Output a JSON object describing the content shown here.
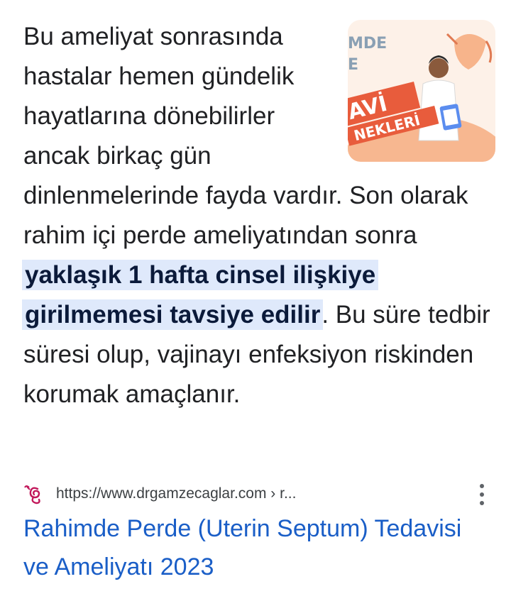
{
  "snippet": {
    "part1": "Bu ameliyat sonrasında hastalar hemen gündelik hayatlarına dönebilirler ancak birkaç gün dinlenmelerinde fayda vardır. Son olarak rahim içi perde ameliyatından sonra ",
    "highlight": "yaklaşık 1 hafta cinsel ilişkiye girilmemesi tavsiye edilir",
    "part2": ". Bu süre tedbir süresi olup, vajinayı enfeksiyon riskinden korumak amaçlanır."
  },
  "thumbnail": {
    "text_line1": "MDE",
    "text_line2": "E",
    "text_line3": "AVİ",
    "text_line4": "NEKLERİ",
    "colors": {
      "bg": "#fdeee3",
      "accent": "#f28b5b",
      "banner": "#e85c3c"
    }
  },
  "source": {
    "url": "https://www.drgamzecaglar.com › r...",
    "favicon_icon": "ovary-swirl-icon",
    "favicon_color": "#c2185b",
    "more_icon": "more-vert-icon"
  },
  "result": {
    "title": "Rahimde Perde (Uterin Septum) Tedavisi ve Ameliyatı 2023",
    "link_color": "#1a5ec7"
  }
}
